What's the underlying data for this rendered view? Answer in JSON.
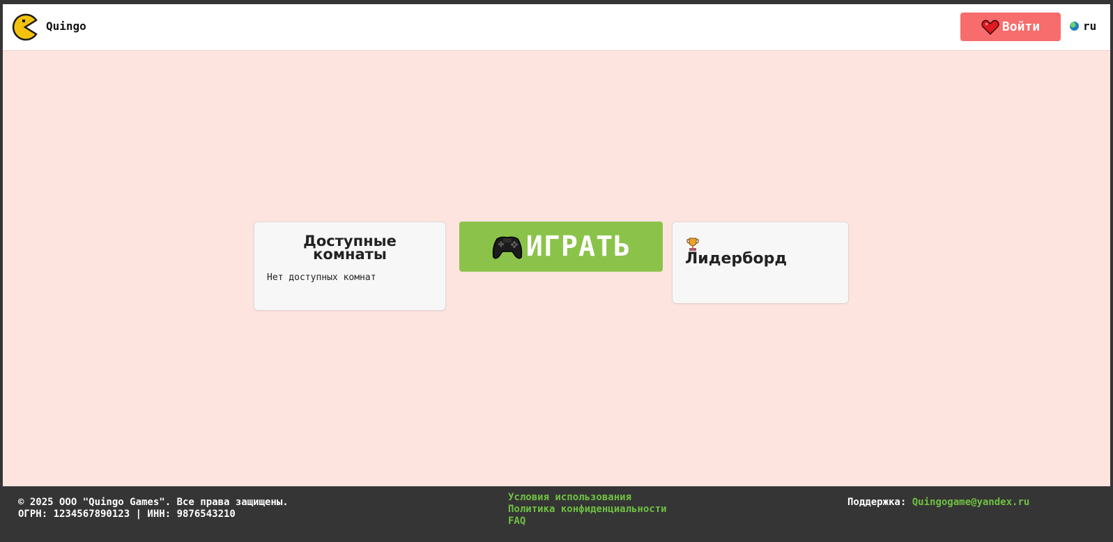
{
  "header": {
    "brand": "Quingo",
    "login_label": "Войти",
    "language": "ru",
    "logo_icon": "pacman-icon",
    "login_icon": "heart-icon",
    "language_icon": "globe-icon"
  },
  "main": {
    "rooms": {
      "title": "Доступные комнаты",
      "empty_text": "Нет доступных комнат"
    },
    "play": {
      "label": "ИГРАТЬ",
      "icon": "gamepad-icon"
    },
    "leaderboard": {
      "title": "Лидерборд",
      "icon": "trophy-icon"
    }
  },
  "footer": {
    "copyright": "© 2025 ООО \"Quingo Games\". Все права защищены.",
    "registration": "ОГРН: 1234567890123 | ИНН: 9876543210",
    "links": [
      "Условия использования",
      "Политика конфиденциальности",
      "FAQ"
    ],
    "support_label": "Поддержка:",
    "support_email": "Quingogame@yandex.ru"
  },
  "colors": {
    "background": "#fde4df",
    "header": "#ffffff",
    "login_button": "#f76c6c",
    "play_button": "#8bc34a",
    "footer": "#353535",
    "link": "#6fc142"
  }
}
